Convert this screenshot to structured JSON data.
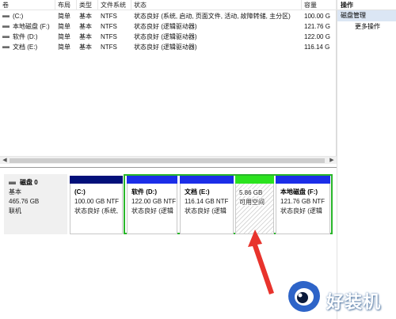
{
  "volume_table": {
    "columns": [
      "卷",
      "布局",
      "类型",
      "文件系统",
      "状态",
      "容量"
    ],
    "rows": [
      {
        "name": "(C:)",
        "layout": "简单",
        "type": "基本",
        "fs": "NTFS",
        "status": "状态良好 (系统, 启动, 页面文件, 活动, 故障转储, 主分区)",
        "capacity": "100.00 G"
      },
      {
        "name": "本地磁盘 (F:)",
        "layout": "简单",
        "type": "基本",
        "fs": "NTFS",
        "status": "状态良好 (逻辑驱动器)",
        "capacity": "121.76 G"
      },
      {
        "name": "软件 (D:)",
        "layout": "简单",
        "type": "基本",
        "fs": "NTFS",
        "status": "状态良好 (逻辑驱动器)",
        "capacity": "122.00 G"
      },
      {
        "name": "文档 (E:)",
        "layout": "简单",
        "type": "基本",
        "fs": "NTFS",
        "status": "状态良好 (逻辑驱动器)",
        "capacity": "116.14 G"
      }
    ]
  },
  "disk": {
    "title": "磁盘 0",
    "type": "基本",
    "size": "465.76 GB",
    "state": "联机"
  },
  "partitions": {
    "c": {
      "name": "(C:)",
      "size": "100.00 GB NTF",
      "status": "状态良好 (系统,"
    },
    "d": {
      "name": "软件  (D:)",
      "size": "122.00 GB NTF",
      "status": "状态良好 (逻辑"
    },
    "e": {
      "name": "文档  (E:)",
      "size": "116.14 GB NTF",
      "status": "状态良好 (逻辑"
    },
    "unalloc": {
      "size": "5.86 GB",
      "status": "可用空间"
    },
    "f": {
      "name": "本地磁盘  (F:)",
      "size": "121.76 GB NTF",
      "status": "状态良好 (逻辑"
    }
  },
  "actions_pane": {
    "header": "操作",
    "section": "磁盘管理",
    "more": "更多操作"
  },
  "watermark": {
    "text": "好装机"
  },
  "colors": {
    "primary_partition": "#02107a",
    "logical_partition": "#1b2ee8",
    "free_space": "#2be31f",
    "extended_border": "#29b62a",
    "annotation_arrow": "#e8332c",
    "selection": "#dbe6f4"
  },
  "icons": {
    "volume_row": "disk-icon",
    "disk": "hard-drive-icon",
    "scroll_left": "arrow-left-icon",
    "scroll_right": "arrow-right-icon",
    "annotation": "red-arrow-icon",
    "watermark_logo": "eye-logo-icon"
  }
}
